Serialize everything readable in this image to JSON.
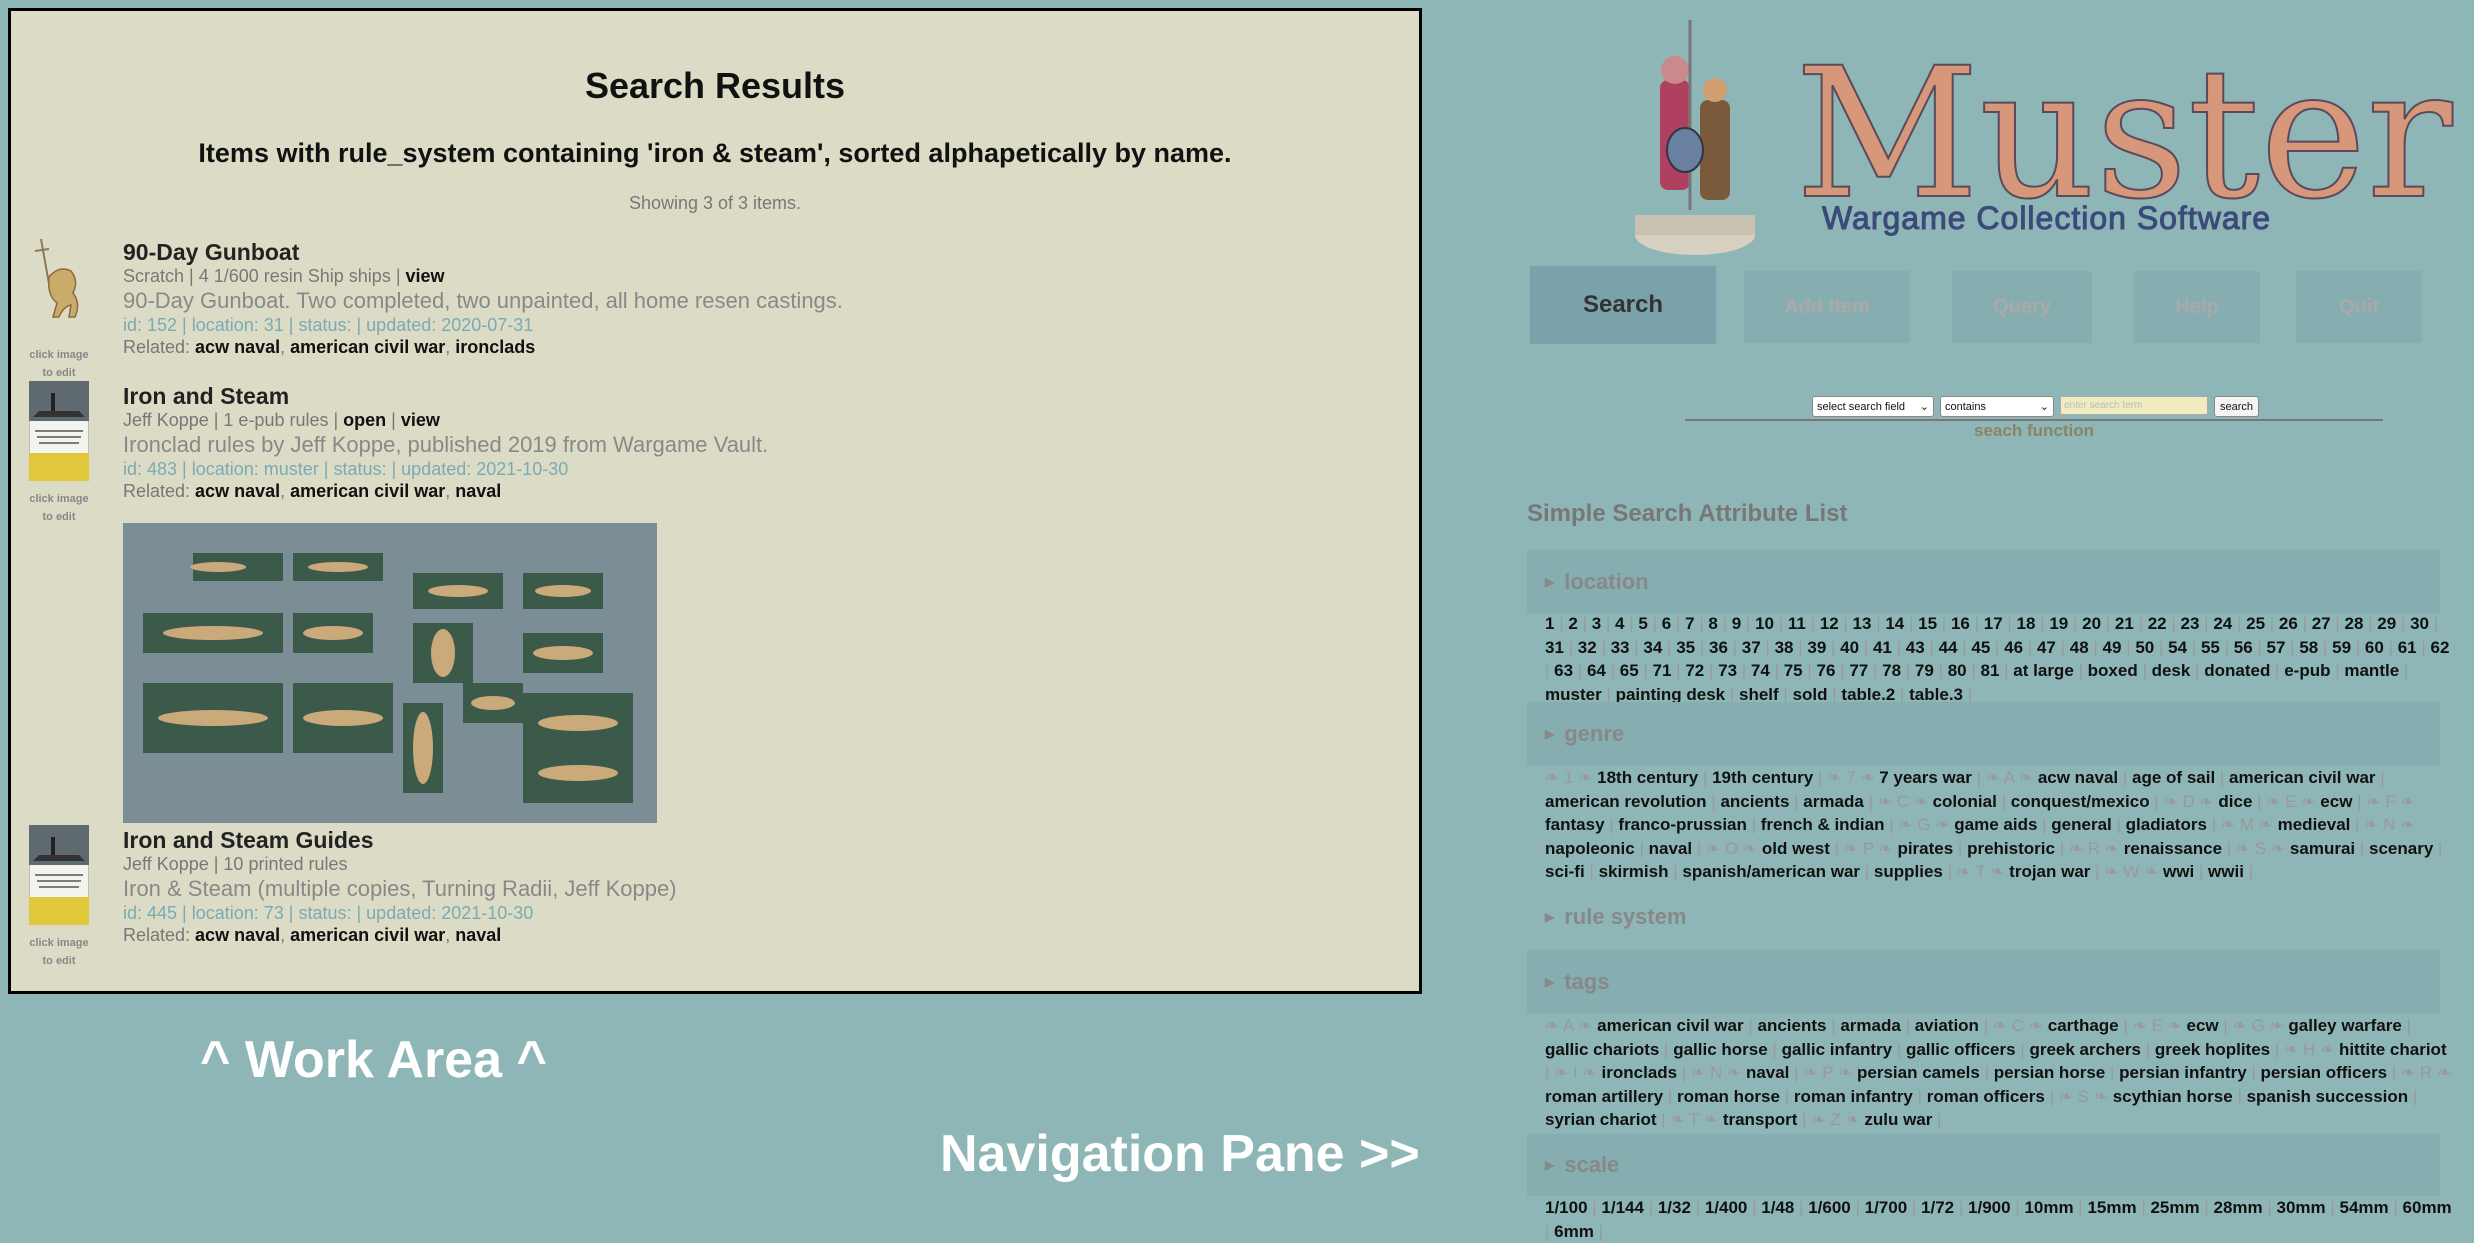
{
  "work_area": {
    "title": "Search Results",
    "subtitle": "Items with rule_system containing 'iron & steam', sorted alphapetically by name.",
    "count": "Showing 3 of 3 items.",
    "thumb_caption_1": "click image",
    "thumb_caption_2": "to edit",
    "items": [
      {
        "name": "90-Day Gunboat",
        "info": "Scratch | 4 1/600 resin Ship ships | ",
        "link1": "view",
        "link2": "",
        "desc": "90-Day Gunboat. Two completed, two unpainted, all home resen castings.",
        "meta": "id: 152 | location: 31 | status: | updated: 2020-07-31",
        "related_label": "Related: ",
        "related": [
          "acw naval",
          "american civil war",
          "ironclads"
        ]
      },
      {
        "name": "Iron and Steam",
        "info": "Jeff Koppe | 1 e-pub rules | ",
        "link1": "open",
        "link2": "view",
        "desc": "Ironclad rules by Jeff Koppe, published 2019 from Wargame Vault.",
        "meta": "id: 483 | location: muster | status: | updated: 2021-10-30",
        "related_label": "Related: ",
        "related": [
          "acw naval",
          "american civil war",
          "naval"
        ]
      },
      {
        "name": "Iron and Steam Guides",
        "info": "Jeff Koppe | 10 printed rules",
        "link1": "",
        "link2": "",
        "desc": "Iron & Steam (multiple copies, Turning Radii, Jeff Koppe)",
        "meta": "id: 445 | location: 73 | status: | updated: 2021-10-30",
        "related_label": "Related: ",
        "related": [
          "acw naval",
          "american civil war",
          "naval"
        ]
      }
    ]
  },
  "labels": {
    "work_area": "^ Work Area ^",
    "nav_pane": "Navigation Pane >>"
  },
  "logo": {
    "title": "Muster",
    "subtitle": "Wargame Collection Software"
  },
  "nav": {
    "search": "Search",
    "add_item": "Add Item",
    "query": "Query",
    "help": "Help",
    "quit": "Quit"
  },
  "search_form": {
    "field": "select search field",
    "op": "contains",
    "placeholder": "enter search term",
    "button": "search",
    "caption": "seach function"
  },
  "attr_list": {
    "title": "Simple Search Attribute List",
    "location": {
      "label": "location",
      "values": [
        "1",
        "2",
        "3",
        "4",
        "5",
        "6",
        "7",
        "8",
        "9",
        "10",
        "11",
        "12",
        "13",
        "14",
        "15",
        "16",
        "17",
        "18",
        "19",
        "20",
        "21",
        "22",
        "23",
        "24",
        "25",
        "26",
        "27",
        "28",
        "29",
        "30",
        "31",
        "32",
        "33",
        "34",
        "35",
        "36",
        "37",
        "38",
        "39",
        "40",
        "41",
        "43",
        "44",
        "45",
        "46",
        "47",
        "48",
        "49",
        "50",
        "54",
        "55",
        "56",
        "57",
        "58",
        "59",
        "60",
        "61",
        "62",
        "63",
        "64",
        "65",
        "71",
        "72",
        "73",
        "74",
        "75",
        "76",
        "77",
        "78",
        "79",
        "80",
        "81",
        "at large",
        "boxed",
        "desk",
        "donated",
        "e-pub",
        "mantle",
        "muster",
        "painting desk",
        "shelf",
        "sold",
        "table.2",
        "table.3"
      ]
    },
    "genre": {
      "label": "genre",
      "values": [
        [
          "1",
          "18th century",
          "19th century"
        ],
        [
          "7",
          "7 years war"
        ],
        [
          "A",
          "acw naval",
          "age of sail",
          "american civil war",
          "american revolution",
          "ancients",
          "armada"
        ],
        [
          "C",
          "colonial",
          "conquest/mexico"
        ],
        [
          "D",
          "dice"
        ],
        [
          "E",
          "ecw"
        ],
        [
          "F",
          "fantasy",
          "franco-prussian",
          "french & indian"
        ],
        [
          "G",
          "game aids",
          "general",
          "gladiators"
        ],
        [
          "M",
          "medieval"
        ],
        [
          "N",
          "napoleonic",
          "naval"
        ],
        [
          "O",
          "old west"
        ],
        [
          "P",
          "pirates",
          "prehistoric"
        ],
        [
          "R",
          "renaissance"
        ],
        [
          "S",
          "samurai",
          "scenary",
          "sci-fi",
          "skirmish",
          "spanish/american war",
          "supplies"
        ],
        [
          "T",
          "trojan war"
        ],
        [
          "W",
          "wwi",
          "wwii"
        ]
      ]
    },
    "rule_system": {
      "label": "rule system"
    },
    "tags": {
      "label": "tags",
      "values": [
        [
          "A",
          "american civil war",
          "ancients",
          "armada",
          "aviation"
        ],
        [
          "C",
          "carthage"
        ],
        [
          "E",
          "ecw"
        ],
        [
          "G",
          "galley warfare",
          "gallic chariots",
          "gallic horse",
          "gallic infantry",
          "gallic officers",
          "greek archers",
          "greek hoplites"
        ],
        [
          "H",
          "hittite chariot"
        ],
        [
          "I",
          "ironclads"
        ],
        [
          "N",
          "naval"
        ],
        [
          "P",
          "persian camels",
          "persian horse",
          "persian infantry",
          "persian officers"
        ],
        [
          "R",
          "roman artillery",
          "roman horse",
          "roman infantry",
          "roman officers"
        ],
        [
          "S",
          "scythian horse",
          "spanish succession",
          "syrian chariot"
        ],
        [
          "T",
          "transport"
        ],
        [
          "Z",
          "zulu war"
        ]
      ]
    },
    "scale": {
      "label": "scale",
      "values": [
        "1/100",
        "1/144",
        "1/32",
        "1/400",
        "1/48",
        "1/600",
        "1/700",
        "1/72",
        "1/900",
        "10mm",
        "15mm",
        "25mm",
        "28mm",
        "30mm",
        "54mm",
        "60mm",
        "6mm"
      ]
    }
  }
}
